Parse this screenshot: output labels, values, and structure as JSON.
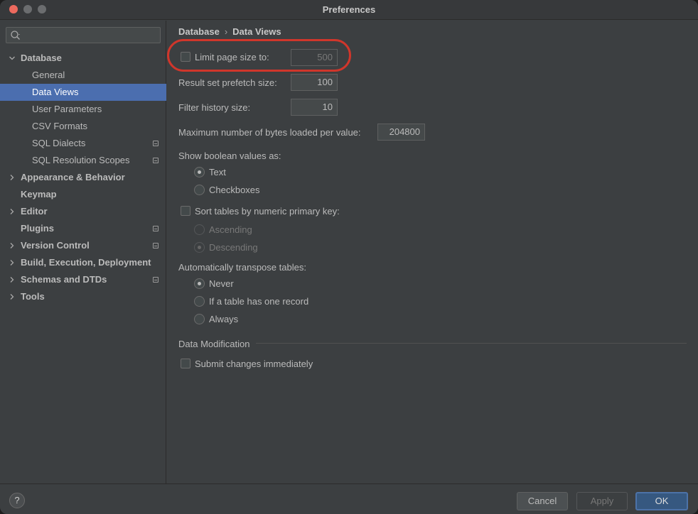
{
  "window": {
    "title": "Preferences"
  },
  "sidebar": {
    "search_placeholder": "",
    "items": [
      {
        "label": "Database",
        "expanded": true
      },
      {
        "label": "General"
      },
      {
        "label": "Data Views",
        "selected": true
      },
      {
        "label": "User Parameters"
      },
      {
        "label": "CSV Formats"
      },
      {
        "label": "SQL Dialects"
      },
      {
        "label": "SQL Resolution Scopes"
      },
      {
        "label": "Appearance & Behavior"
      },
      {
        "label": "Keymap"
      },
      {
        "label": "Editor"
      },
      {
        "label": "Plugins"
      },
      {
        "label": "Version Control"
      },
      {
        "label": "Build, Execution, Deployment"
      },
      {
        "label": "Schemas and DTDs"
      },
      {
        "label": "Tools"
      }
    ]
  },
  "breadcrumb": {
    "parent": "Database",
    "separator": "›",
    "current": "Data Views"
  },
  "settings": {
    "limit_page": {
      "label": "Limit page size to:",
      "value": "500",
      "checked": false
    },
    "prefetch": {
      "label": "Result set prefetch size:",
      "value": "100"
    },
    "filter_history": {
      "label": "Filter history size:",
      "value": "10"
    },
    "max_bytes": {
      "label": "Maximum number of bytes loaded per value:",
      "value": "204800"
    },
    "boolean": {
      "label": "Show boolean values as:",
      "options": [
        "Text",
        "Checkboxes"
      ],
      "selected": "Text"
    },
    "sort_tables": {
      "label": "Sort tables by numeric primary key:",
      "checked": false,
      "options": [
        "Ascending",
        "Descending"
      ],
      "selected": "Descending"
    },
    "transpose": {
      "label": "Automatically transpose tables:",
      "options": [
        "Never",
        "If a table has one record",
        "Always"
      ],
      "selected": "Never"
    },
    "data_modification": {
      "heading": "Data Modification",
      "submit_label": "Submit changes immediately",
      "submit_checked": false
    }
  },
  "footer": {
    "help": "?",
    "cancel": "Cancel",
    "apply": "Apply",
    "ok": "OK"
  },
  "colors": {
    "selection": "#4b6eaf",
    "highlight_ring": "#d0362b",
    "primary_button": "#365880"
  }
}
